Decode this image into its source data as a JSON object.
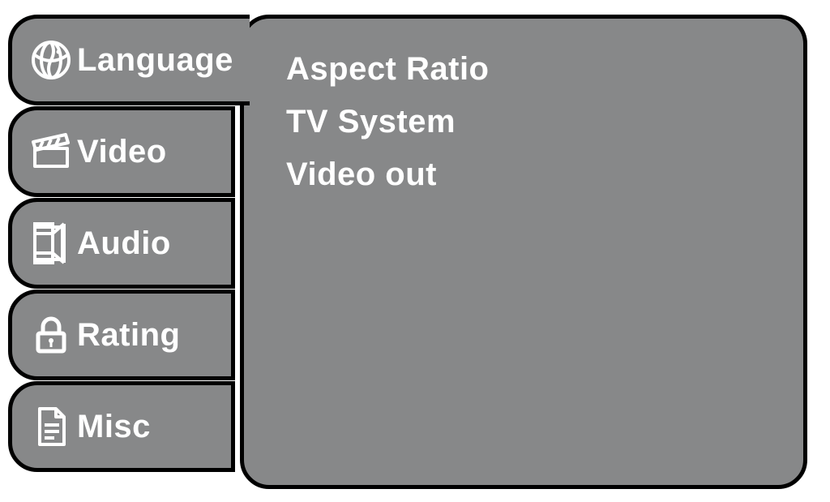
{
  "sidebar": {
    "tabs": [
      {
        "label": "Language",
        "icon": "globe-icon"
      },
      {
        "label": "Video",
        "icon": "clapperboard-icon"
      },
      {
        "label": "Audio",
        "icon": "speaker-icon"
      },
      {
        "label": "Rating",
        "icon": "padlock-icon"
      },
      {
        "label": "Misc",
        "icon": "document-icon"
      }
    ],
    "active_index": 0
  },
  "panel": {
    "items": [
      {
        "label": "Aspect Ratio"
      },
      {
        "label": "TV System"
      },
      {
        "label": "Video out"
      }
    ]
  }
}
